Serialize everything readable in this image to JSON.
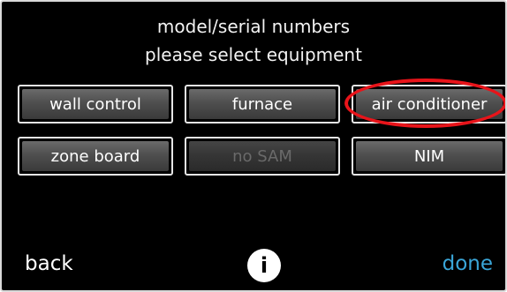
{
  "header": {
    "title": "model/serial numbers",
    "subtitle": "please select equipment"
  },
  "equipment_buttons": [
    {
      "label": "wall control",
      "enabled": true
    },
    {
      "label": "furnace",
      "enabled": true
    },
    {
      "label": "air conditioner",
      "enabled": true,
      "highlighted": true
    },
    {
      "label": "zone board",
      "enabled": true
    },
    {
      "label": "no SAM",
      "enabled": false
    },
    {
      "label": "NIM",
      "enabled": true
    }
  ],
  "footer": {
    "back_label": "back",
    "info_icon": "info-icon",
    "info_glyph": "i",
    "done_label": "done"
  },
  "colors": {
    "background": "#000000",
    "done_accent": "#3aa6d8",
    "highlight_ring": "#e8141a",
    "disabled_text": "#6a6a6a"
  }
}
